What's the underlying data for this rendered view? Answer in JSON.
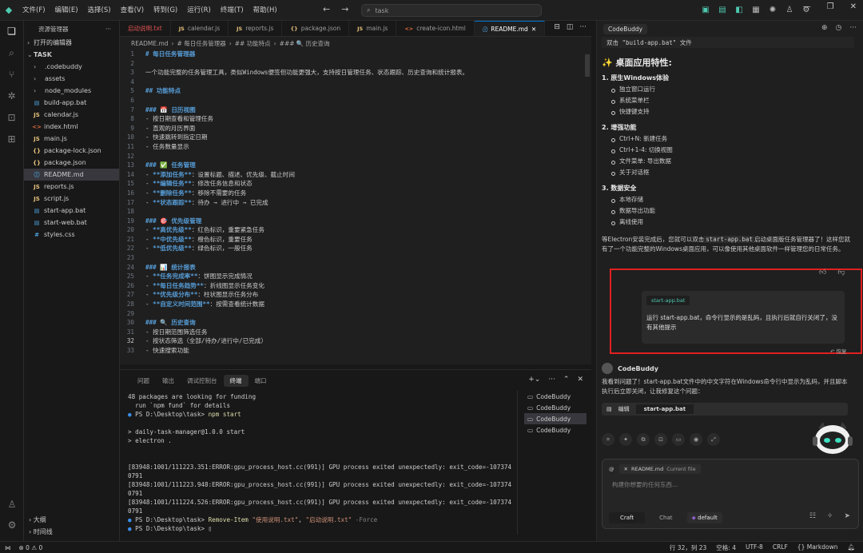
{
  "titlebar": {
    "menu": [
      "文件(F)",
      "编辑(E)",
      "选择(S)",
      "查看(V)",
      "转到(G)",
      "运行(R)",
      "终端(T)",
      "帮助(H)"
    ],
    "search_placeholder": "task"
  },
  "sidebar": {
    "title": "资源管理器",
    "more": "···",
    "open_editors": "打开的编辑器",
    "folder": "TASK",
    "items": [
      {
        "name": ".codebuddy",
        "type": "folder",
        "icon": "›"
      },
      {
        "name": "assets",
        "type": "folder",
        "icon": "›"
      },
      {
        "name": "node_modules",
        "type": "folder",
        "icon": "›"
      },
      {
        "name": "build-app.bat",
        "type": "file",
        "icon": "▤",
        "color": "#4fa3e0"
      },
      {
        "name": "calendar.js",
        "type": "file",
        "icon": "JS",
        "color": "#e5c07b"
      },
      {
        "name": "index.html",
        "type": "file",
        "icon": "<>",
        "color": "#e06c3e"
      },
      {
        "name": "main.js",
        "type": "file",
        "icon": "JS",
        "color": "#e5c07b"
      },
      {
        "name": "package-lock.json",
        "type": "file",
        "icon": "{}",
        "color": "#e5c07b"
      },
      {
        "name": "package.json",
        "type": "file",
        "icon": "{}",
        "color": "#e5c07b"
      },
      {
        "name": "README.md",
        "type": "file",
        "icon": "ⓘ",
        "color": "#4fa3e0",
        "selected": true
      },
      {
        "name": "reports.js",
        "type": "file",
        "icon": "JS",
        "color": "#e5c07b"
      },
      {
        "name": "script.js",
        "type": "file",
        "icon": "JS",
        "color": "#e5c07b"
      },
      {
        "name": "start-app.bat",
        "type": "file",
        "icon": "▤",
        "color": "#4fa3e0"
      },
      {
        "name": "start-web.bat",
        "type": "file",
        "icon": "▤",
        "color": "#4fa3e0"
      },
      {
        "name": "styles.css",
        "type": "file",
        "icon": "#",
        "color": "#4fa3e0"
      }
    ],
    "outline": "大纲",
    "timeline": "时间线"
  },
  "editor": {
    "tabs": [
      {
        "label": "启动说明.txt",
        "icon": "",
        "color": "#e05252"
      },
      {
        "label": "calendar.js",
        "icon": "JS",
        "color": "#e5c07b"
      },
      {
        "label": "reports.js",
        "icon": "JS",
        "color": "#e5c07b"
      },
      {
        "label": "package.json",
        "icon": "{}",
        "color": "#e5c07b"
      },
      {
        "label": "main.js",
        "icon": "JS",
        "color": "#e5c07b"
      },
      {
        "label": "create-icon.html",
        "icon": "<>",
        "color": "#e06c3e"
      },
      {
        "label": "README.md",
        "icon": "ⓘ",
        "color": "#4fa3e0",
        "active": true
      }
    ],
    "breadcrumb": [
      "README.md",
      "# 每日任务管理器",
      "## 功能特点",
      "### 🔍 历史查询"
    ],
    "lines": [
      {
        "n": "1",
        "t": "h",
        "text": "# 每日任务管理器"
      },
      {
        "n": "2",
        "t": "t",
        "text": ""
      },
      {
        "n": "3",
        "t": "t",
        "text": "一个功能完整的任务管理工具，类似Windows便签但功能更强大，支持按日管理任务、状态跟踪、历史查询和统计报表。"
      },
      {
        "n": "4",
        "t": "t",
        "text": ""
      },
      {
        "n": "5",
        "t": "h",
        "text": "## 功能特点"
      },
      {
        "n": "6",
        "t": "t",
        "text": ""
      },
      {
        "n": "7",
        "t": "h",
        "text": "### 📅 日历视图"
      },
      {
        "n": "8",
        "t": "t",
        "text": "- 按日期查看和管理任务"
      },
      {
        "n": "9",
        "t": "t",
        "text": "- 直观的月历界面"
      },
      {
        "n": "10",
        "t": "t",
        "text": "- 快速跳转到指定日期"
      },
      {
        "n": "11",
        "t": "t",
        "text": "- 任务数量显示"
      },
      {
        "n": "12",
        "t": "t",
        "text": ""
      },
      {
        "n": "13",
        "t": "h",
        "text": "### ✅ 任务管理"
      },
      {
        "n": "14",
        "t": "l",
        "bold": "**添加任务**",
        "rest": "：设置标题、描述、优先级、截止时间"
      },
      {
        "n": "15",
        "t": "l",
        "bold": "**编辑任务**",
        "rest": "：修改任务信息和状态"
      },
      {
        "n": "16",
        "t": "l",
        "bold": "**删除任务**",
        "rest": "：移除不需要的任务"
      },
      {
        "n": "17",
        "t": "l",
        "bold": "**状态跟踪**",
        "rest": "：待办 → 进行中 → 已完成"
      },
      {
        "n": "18",
        "t": "t",
        "text": ""
      },
      {
        "n": "19",
        "t": "h",
        "text": "### 🎯 优先级管理"
      },
      {
        "n": "20",
        "t": "l",
        "bold": "**高优先级**",
        "rest": "：红色标识，重要紧急任务"
      },
      {
        "n": "21",
        "t": "l",
        "bold": "**中优先级**",
        "rest": "：橙色标识，重要任务"
      },
      {
        "n": "22",
        "t": "l",
        "bold": "**低优先级**",
        "rest": "：绿色标识，一般任务"
      },
      {
        "n": "23",
        "t": "t",
        "text": ""
      },
      {
        "n": "24",
        "t": "h",
        "text": "### 📊 统计报表"
      },
      {
        "n": "25",
        "t": "l",
        "bold": "**任务完成率**",
        "rest": "：饼图显示完成情况"
      },
      {
        "n": "26",
        "t": "l",
        "bold": "**每日任务趋势**",
        "rest": "：折线图显示任务变化"
      },
      {
        "n": "27",
        "t": "l",
        "bold": "**优先级分布**",
        "rest": "：柱状图显示任务分布"
      },
      {
        "n": "28",
        "t": "l",
        "bold": "**自定义时间范围**",
        "rest": "：按需查看统计数据"
      },
      {
        "n": "29",
        "t": "t",
        "text": ""
      },
      {
        "n": "30",
        "t": "h",
        "text": "### 🔍 历史查询"
      },
      {
        "n": "31",
        "t": "t",
        "text": "- 按日期范围筛选任务"
      },
      {
        "n": "32",
        "t": "t",
        "text": "- 按状态筛选（全部/待办/进行中/已完成）",
        "cur": true
      },
      {
        "n": "33",
        "t": "t",
        "text": "- 快速搜索功能"
      }
    ]
  },
  "panel": {
    "tabs": [
      "问题",
      "输出",
      "调试控制台",
      "终端",
      "端口"
    ],
    "active_tab": "终端",
    "terminal": [
      {
        "c": "",
        "text": "48 packages are looking for funding"
      },
      {
        "c": "",
        "text": "  run `npm fund` for details"
      },
      {
        "c": "prompt",
        "text": "PS D:\\Desktop\\task> ",
        "cmd": "npm start"
      },
      {
        "c": "",
        "text": ""
      },
      {
        "c": "",
        "text": "> daily-task-manager@1.0.0 start"
      },
      {
        "c": "",
        "text": "> electron ."
      },
      {
        "c": "",
        "text": ""
      },
      {
        "c": "",
        "text": ""
      },
      {
        "c": "",
        "text": "[83948:1001/111223.351:ERROR:gpu_process_host.cc(991)] GPU process exited unexpectedly: exit_code=-107374"
      },
      {
        "c": "",
        "text": "0791"
      },
      {
        "c": "",
        "text": "[83948:1001/111223.948:ERROR:gpu_process_host.cc(991)] GPU process exited unexpectedly: exit_code=-107374"
      },
      {
        "c": "",
        "text": "0791"
      },
      {
        "c": "",
        "text": "[83948:1001/111224.526:ERROR:gpu_process_host.cc(991)] GPU process exited unexpectedly: exit_code=-107374"
      },
      {
        "c": "",
        "text": "0791"
      },
      {
        "c": "remove",
        "text": "PS D:\\Desktop\\task> ",
        "cmd": "Remove-Item",
        "a1": "\"使用说明.txt\"",
        "sep": ", ",
        "a2": "\"启动说明.txt\"",
        "flag": " -Force"
      },
      {
        "c": "prompt2",
        "text": "PS D:\\Desktop\\task> "
      }
    ],
    "terminals": [
      "CodeBuddy",
      "CodeBuddy",
      "CodeBuddy",
      "CodeBuddy"
    ]
  },
  "right": {
    "tab": "CodeBuddy",
    "snippet": "双击 \"build-app.bat\" 文件",
    "heading": "✨ 桌面应用特性:",
    "sections": [
      {
        "title": "1. 原生Windows体验",
        "items": [
          "独立窗口运行",
          "系统菜单栏",
          "快捷键支持"
        ]
      },
      {
        "title": "2. 增强功能",
        "items": [
          "Ctrl+N: 新建任务",
          "Ctrl+1-4: 切换视图",
          "文件菜单: 导出数据",
          "关于对话框"
        ]
      },
      {
        "title": "3. 数据安全",
        "items": [
          "本地存储",
          "数据导出功能",
          "离线使用"
        ]
      }
    ],
    "para_a": "等Electron安装完成后，您就可以双击",
    "para_code": "start-app.bat",
    "para_b": "启动桌面版任务管理器了！这样您就有了一个功能完整的Windows桌面应用，可以像使用其他桌面软件一样管理您的日常任务。",
    "user_file": "start-app.bat",
    "user_text": "运行 start-app.bat，命令行显示的是乱码，且执行后就自行关闭了，没有其他提示",
    "restore": "恢复",
    "resp_name": "CodeBuddy",
    "resp_text": "我看到问题了！start-app.bat文件中的中文字符在Windows命令行中显示为乱码，并且脚本执行后立即关闭，让我修复这个问题：",
    "edit_label": "编辑",
    "edit_file": "start-app.bat",
    "ctx_file": "README.md",
    "ctx_tag": "Current file",
    "placeholder": "构建你想要的任何东西...",
    "modes": [
      "Craft",
      "Chat"
    ],
    "model": "default"
  },
  "status": {
    "errors": "0",
    "warnings": "0",
    "position": "行 32，列 23",
    "spaces": "空格: 4",
    "encoding": "UTF-8",
    "eol": "CRLF",
    "lang": "Markdown"
  }
}
